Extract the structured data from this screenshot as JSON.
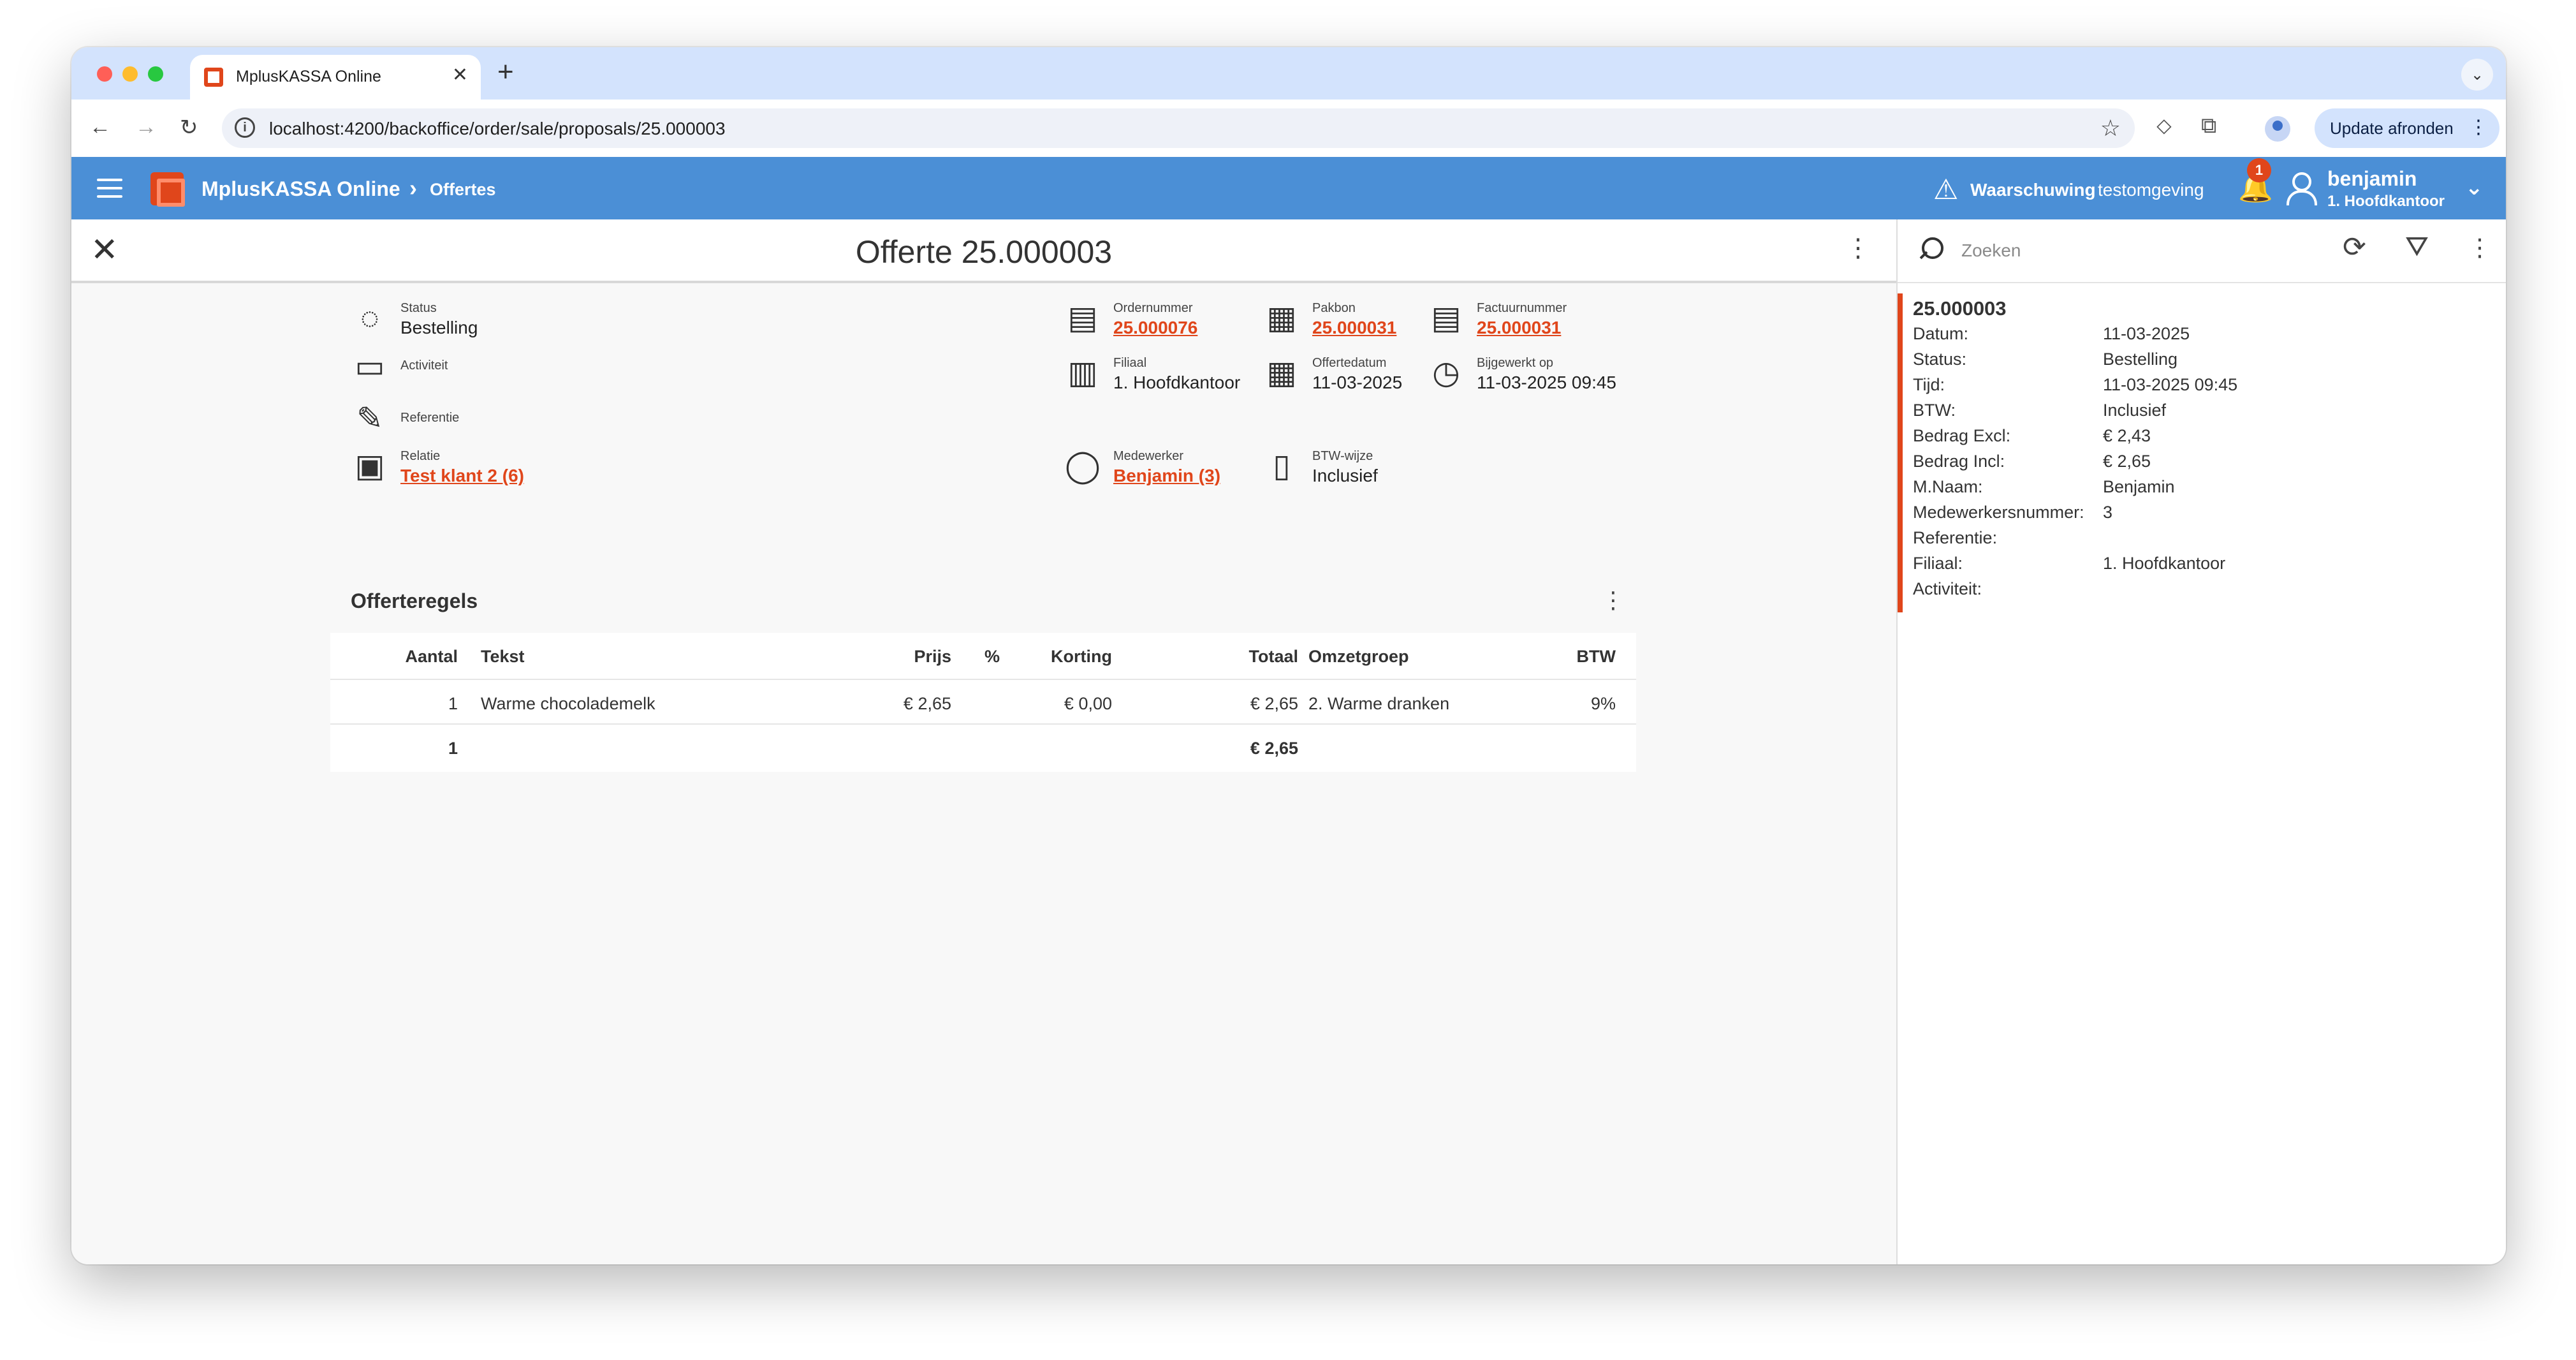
{
  "browser": {
    "tab_title": "MplusKASSA Online",
    "tab_close": "✕",
    "new_tab": "+",
    "tab_menu": "⌄",
    "url": "localhost:4200/backoffice/order/sale/proposals/25.000003",
    "update_button": "Update afronden",
    "update_menu": "⋮"
  },
  "app": {
    "title": "MplusKASSA Online",
    "breadcrumb_sep": "›",
    "breadcrumb": "Offertes",
    "warning_strong": "Waarschuwing",
    "warning_rest": "testomgeving",
    "notification_count": "1",
    "user_name": "benjamin",
    "user_branch": "1. Hoofdkantoor",
    "user_chevron": "⌄"
  },
  "detail": {
    "close": "✕",
    "title": "Offerte 25.000003",
    "menu": "⋮",
    "fields": {
      "status": {
        "label": "Status",
        "value": "Bestelling"
      },
      "activiteit": {
        "label": "Activiteit"
      },
      "referentie": {
        "label": "Referentie"
      },
      "relatie": {
        "label": "Relatie",
        "value": "Test klant 2 (6)"
      },
      "ordernummer": {
        "label": "Ordernummer",
        "value": "25.000076"
      },
      "pakbon": {
        "label": "Pakbon",
        "value": "25.000031"
      },
      "factuurnummer": {
        "label": "Factuurnummer",
        "value": "25.000031"
      },
      "filiaal": {
        "label": "Filiaal",
        "value": "1. Hoofdkantoor"
      },
      "offertedatum": {
        "label": "Offertedatum",
        "value": "11-03-2025"
      },
      "bijgewerkt": {
        "label": "Bijgewerkt op",
        "value": "11-03-2025 09:45"
      },
      "medewerker": {
        "label": "Medewerker",
        "value": "Benjamin (3)"
      },
      "btw_wijze": {
        "label": "BTW-wijze",
        "value": "Inclusief"
      }
    },
    "section_title": "Offerteregels",
    "section_menu": "⋮",
    "table": {
      "headers": {
        "aantal": "Aantal",
        "tekst": "Tekst",
        "prijs": "Prijs",
        "pct": "%",
        "korting": "Korting",
        "totaal": "Totaal",
        "omzetgroep": "Omzetgroep",
        "btw": "BTW"
      },
      "rows": [
        {
          "aantal": "1",
          "tekst": "Warme chocolademelk",
          "prijs": "€ 2,65",
          "pct": "",
          "korting": "€ 0,00",
          "totaal": "€ 2,65",
          "omzetgroep": "2. Warme dranken",
          "btw": "9%"
        }
      ],
      "totals": {
        "aantal": "1",
        "totaal": "€ 2,65"
      }
    }
  },
  "side": {
    "search_placeholder": "Zoeken",
    "refresh": "⟳",
    "filter": "⛛",
    "menu": "⋮",
    "card": {
      "title": "25.000003",
      "items": [
        {
          "key": "Datum:",
          "value": "11-03-2025"
        },
        {
          "key": "Status:",
          "value": "Bestelling"
        },
        {
          "key": "Tijd:",
          "value": "11-03-2025 09:45"
        },
        {
          "key": "BTW:",
          "value": "Inclusief"
        },
        {
          "key": "Bedrag Excl:",
          "value": "€ 2,43"
        },
        {
          "key": "Bedrag Incl:",
          "value": "€ 2,65"
        },
        {
          "key": "M.Naam:",
          "value": "Benjamin"
        },
        {
          "key": "Medewerkersnummer:",
          "value": "3"
        },
        {
          "key": "Referentie:",
          "value": ""
        },
        {
          "key": "Filiaal:",
          "value": "1. Hoofdkantoor"
        },
        {
          "key": "Activiteit:",
          "value": ""
        }
      ]
    }
  },
  "icons": {
    "back": "←",
    "forward": "→",
    "reload": "↻",
    "info": "i",
    "star": "☆",
    "extension": "⬦",
    "puzzle": "⧉",
    "warning": "⚠",
    "bell": "🔔",
    "status": "◌",
    "activiteit": "▭",
    "referentie": "✎",
    "relatie": "▣",
    "ordernummer": "▤",
    "pakbon": "▦",
    "factuurnummer": "▤",
    "filiaal": "▥",
    "offertedatum": "▦",
    "bijgewerkt": "◷",
    "medewerker": "◯",
    "btw_wijze": "▯"
  },
  "colors": {
    "accent": "#e0461b",
    "header": "#4b8fd6",
    "tabstrip": "#d3e3fd"
  }
}
